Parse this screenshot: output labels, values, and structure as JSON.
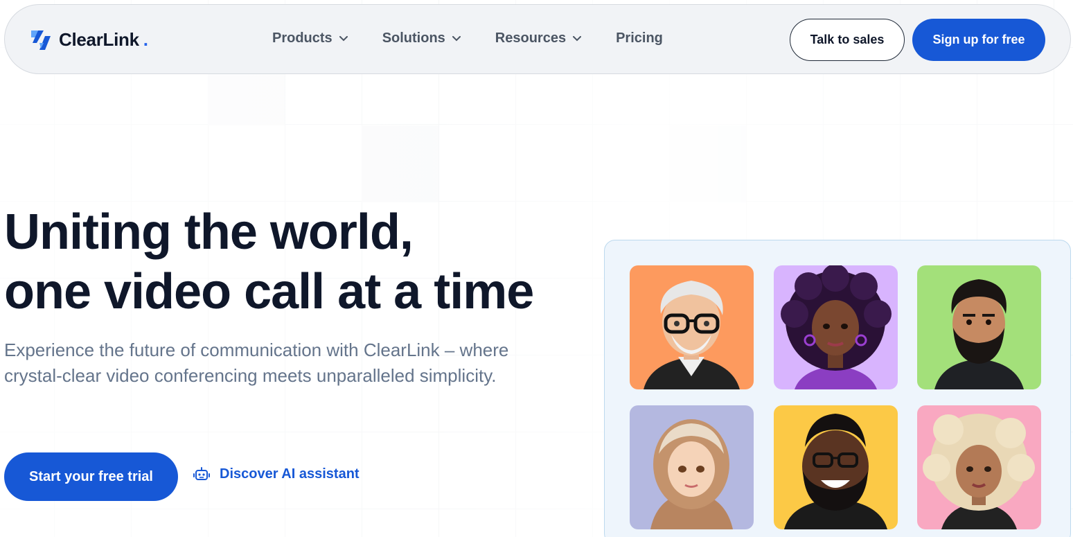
{
  "brand": {
    "name": "ClearLink",
    "dot": ".",
    "accent": "#1758d6"
  },
  "nav": {
    "links": [
      {
        "label": "Products",
        "has_dropdown": true
      },
      {
        "label": "Solutions",
        "has_dropdown": true
      },
      {
        "label": "Resources",
        "has_dropdown": true
      },
      {
        "label": "Pricing",
        "has_dropdown": false
      }
    ],
    "talk_to_sales": "Talk to sales",
    "sign_up": "Sign up for free"
  },
  "hero": {
    "title_line1": "Uniting the world,",
    "title_line2": "one video call at a time",
    "subtitle": "Experience the future of communication with ClearLink – where crystal-clear video conferencing meets unparalleled simplicity.",
    "cta_primary": "Start your free trial",
    "cta_secondary": "Discover AI assistant",
    "cta_secondary_icon": "robot-icon"
  },
  "participants": [
    {
      "name": "participant-1",
      "bg": "#fd9a5e"
    },
    {
      "name": "participant-2",
      "bg": "#d8b4fe"
    },
    {
      "name": "participant-3",
      "bg": "#a3e07a"
    },
    {
      "name": "participant-4",
      "bg": "#b4b8e0"
    },
    {
      "name": "participant-5",
      "bg": "#fcc946"
    },
    {
      "name": "participant-6",
      "bg": "#f9a8c1"
    }
  ]
}
